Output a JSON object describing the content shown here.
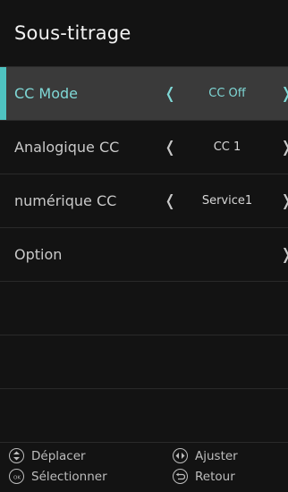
{
  "header": {
    "title": "Sous-titrage"
  },
  "menu": {
    "items": [
      {
        "label": "CC Mode",
        "value": "CC Off",
        "has_left_arrow": true,
        "has_right_arrow": true,
        "selected": true
      },
      {
        "label": "Analogique CC",
        "value": "CC 1",
        "has_left_arrow": true,
        "has_right_arrow": true,
        "selected": false
      },
      {
        "label": "numérique CC",
        "value": "Service1",
        "has_left_arrow": true,
        "has_right_arrow": true,
        "selected": false
      },
      {
        "label": "Option",
        "value": "",
        "has_left_arrow": false,
        "has_right_arrow": true,
        "selected": false
      }
    ]
  },
  "footer": {
    "hints": [
      {
        "icon": "up-down-icon",
        "label": "Déplacer"
      },
      {
        "icon": "ok-icon",
        "label": "Sélectionner"
      },
      {
        "icon": "left-right-icon",
        "label": "Ajuster"
      },
      {
        "icon": "back-icon",
        "label": "Retour"
      }
    ]
  },
  "colors": {
    "accent": "#4fc3c1",
    "selected_text": "#7fd8d6",
    "selected_row_bg": "#3a3a3a",
    "panel_bg": "#131313"
  }
}
